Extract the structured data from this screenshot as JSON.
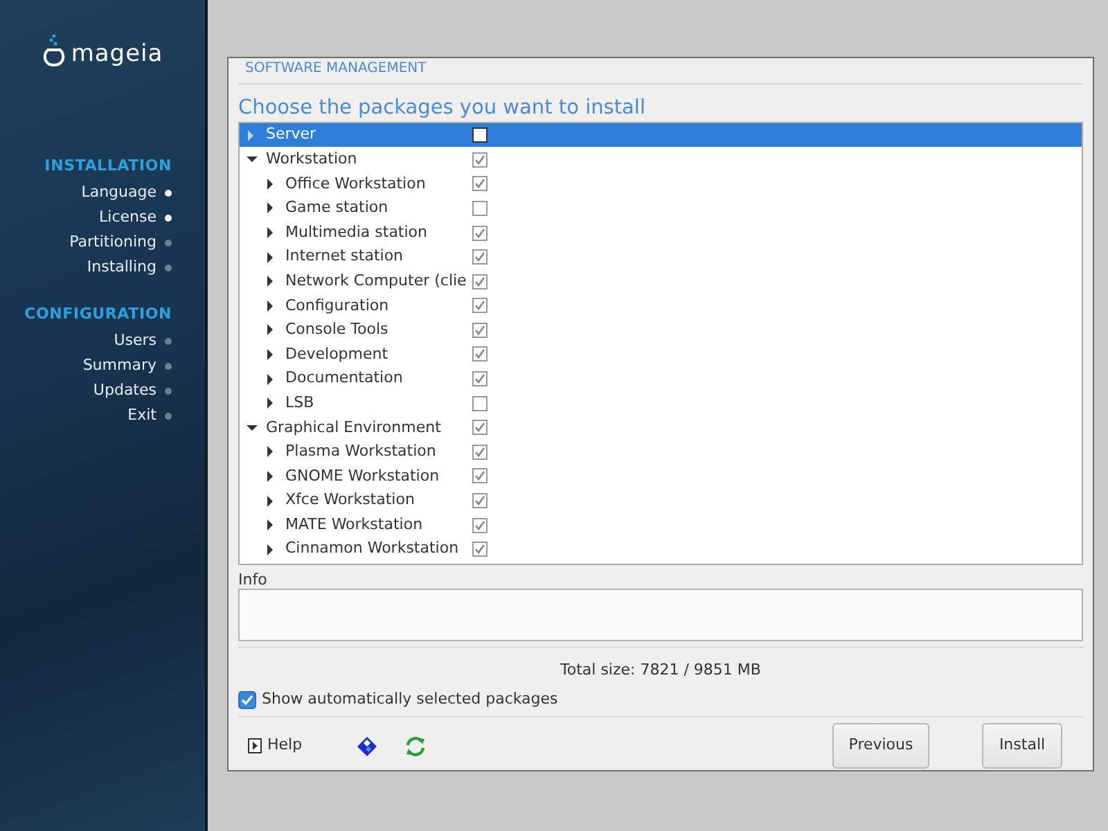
{
  "sidebar": {
    "logo": "mageia",
    "sections": [
      {
        "title": "INSTALLATION",
        "steps": [
          {
            "label": "Language",
            "completed": true
          },
          {
            "label": "License",
            "completed": true
          },
          {
            "label": "Partitioning",
            "completed": false
          },
          {
            "label": "Installing",
            "completed": false
          }
        ]
      },
      {
        "title": "CONFIGURATION",
        "steps": [
          {
            "label": "Users",
            "completed": false
          },
          {
            "label": "Summary",
            "completed": false
          },
          {
            "label": "Updates",
            "completed": false
          },
          {
            "label": "Exit",
            "completed": false
          }
        ]
      }
    ]
  },
  "dialog": {
    "header": "SOFTWARE MANAGEMENT",
    "title": "Choose the packages you want to install",
    "tree": [
      {
        "label": "Server",
        "checked": false,
        "expanded": false,
        "selected": true
      },
      {
        "label": "Workstation",
        "checked": true,
        "expanded": true,
        "selected": false,
        "children": [
          {
            "label": "Office Workstation",
            "checked": true,
            "expanded": false,
            "selected": false
          },
          {
            "label": "Game station",
            "checked": false,
            "expanded": false,
            "selected": false
          },
          {
            "label": "Multimedia station",
            "checked": true,
            "expanded": false,
            "selected": false
          },
          {
            "label": "Internet station",
            "checked": true,
            "expanded": false,
            "selected": false
          },
          {
            "label": "Network Computer (clie",
            "checked": true,
            "expanded": false,
            "selected": false
          },
          {
            "label": "Configuration",
            "checked": true,
            "expanded": false,
            "selected": false
          },
          {
            "label": "Console Tools",
            "checked": true,
            "expanded": false,
            "selected": false
          },
          {
            "label": "Development",
            "checked": true,
            "expanded": false,
            "selected": false
          },
          {
            "label": "Documentation",
            "checked": true,
            "expanded": false,
            "selected": false
          },
          {
            "label": "LSB",
            "checked": false,
            "expanded": false,
            "selected": false
          }
        ]
      },
      {
        "label": "Graphical Environment",
        "checked": true,
        "expanded": true,
        "selected": false,
        "children": [
          {
            "label": "Plasma Workstation",
            "checked": true,
            "expanded": false,
            "selected": false
          },
          {
            "label": "GNOME Workstation",
            "checked": true,
            "expanded": false,
            "selected": false
          },
          {
            "label": "Xfce Workstation",
            "checked": true,
            "expanded": false,
            "selected": false
          },
          {
            "label": "MATE Workstation",
            "checked": true,
            "expanded": false,
            "selected": false
          },
          {
            "label": "Cinnamon Workstation",
            "checked": true,
            "expanded": false,
            "selected": false
          }
        ]
      }
    ],
    "info_label": "Info",
    "total_size": "Total size: 7821 / 9851 MB",
    "show_auto": {
      "label": "Show automatically selected packages",
      "checked": true
    },
    "help": "Help",
    "buttons": [
      "Previous",
      "Install"
    ]
  }
}
